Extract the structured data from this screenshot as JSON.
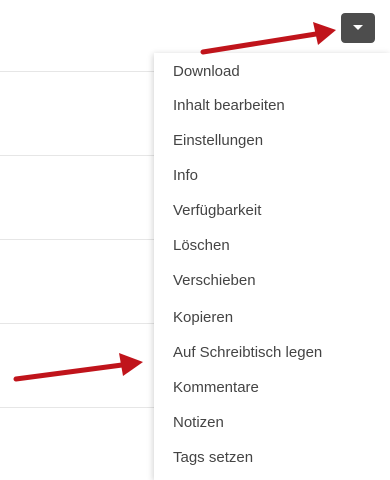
{
  "dropdown": {
    "toggle_icon": "caret-down-icon",
    "items": [
      {
        "label": "Download"
      },
      {
        "label": "Inhalt bearbeiten"
      },
      {
        "label": "Einstellungen"
      },
      {
        "label": "Info"
      },
      {
        "label": "Verfügbarkeit"
      },
      {
        "label": "Löschen"
      },
      {
        "label": "Verschieben"
      },
      {
        "label": "Kopieren"
      },
      {
        "label": "Auf Schreibtisch legen"
      },
      {
        "label": "Kommentare"
      },
      {
        "label": "Notizen"
      },
      {
        "label": "Tags setzen"
      }
    ]
  },
  "annotations": {
    "arrow_color": "#c0141b"
  },
  "colors": {
    "button_bg": "#4d4d4d",
    "menu_text": "#444444",
    "divider": "#e6e6e6"
  }
}
